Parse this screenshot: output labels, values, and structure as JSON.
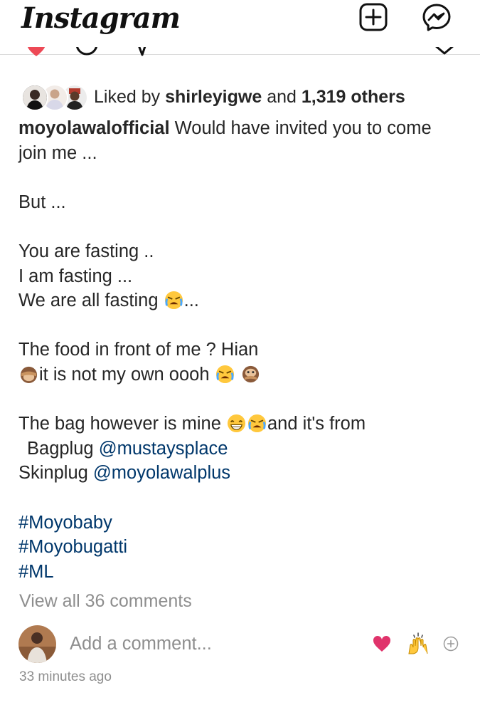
{
  "app": {
    "logo_text": "Instagram"
  },
  "header_icons": [
    "new-post-icon",
    "messenger-icon"
  ],
  "likes": {
    "prefix": "Liked by",
    "user": "shirleyigwe",
    "conjunction": "and",
    "others": "1,319 others"
  },
  "caption": {
    "username": "moyolawalofficial",
    "l1": "Would have invited you to come",
    "l2": "join me ...",
    "l3": "But ...",
    "l4": "You are fasting ..",
    "l5": "I am fasting ...",
    "l6a": "We are all fasting",
    "l6b": "...",
    "l7": "The food in front of me ? Hian",
    "l8": "it is not my own oooh",
    "l9a": "The bag however is mine",
    "l9b": "and it's from",
    "l10a": "Bagplug",
    "l10b": "@mustaysplace",
    "l11a": "Skinplug",
    "l11b": "@moyolawalplus",
    "tags": [
      "#Moyobaby",
      "#Moyobugatti",
      "#ML"
    ]
  },
  "comments": {
    "view_all": "View all 36 comments",
    "placeholder": "Add a comment...",
    "quick_reactions": [
      "heart-emoji",
      "raised-hands-emoji",
      "add-reaction-icon"
    ]
  },
  "timestamp": "33 minutes ago",
  "colors": {
    "text": "#262626",
    "muted": "#8e8e8e",
    "link": "#00376b",
    "like_red": "#ed4956",
    "reaction_pink": "#e0336b"
  }
}
